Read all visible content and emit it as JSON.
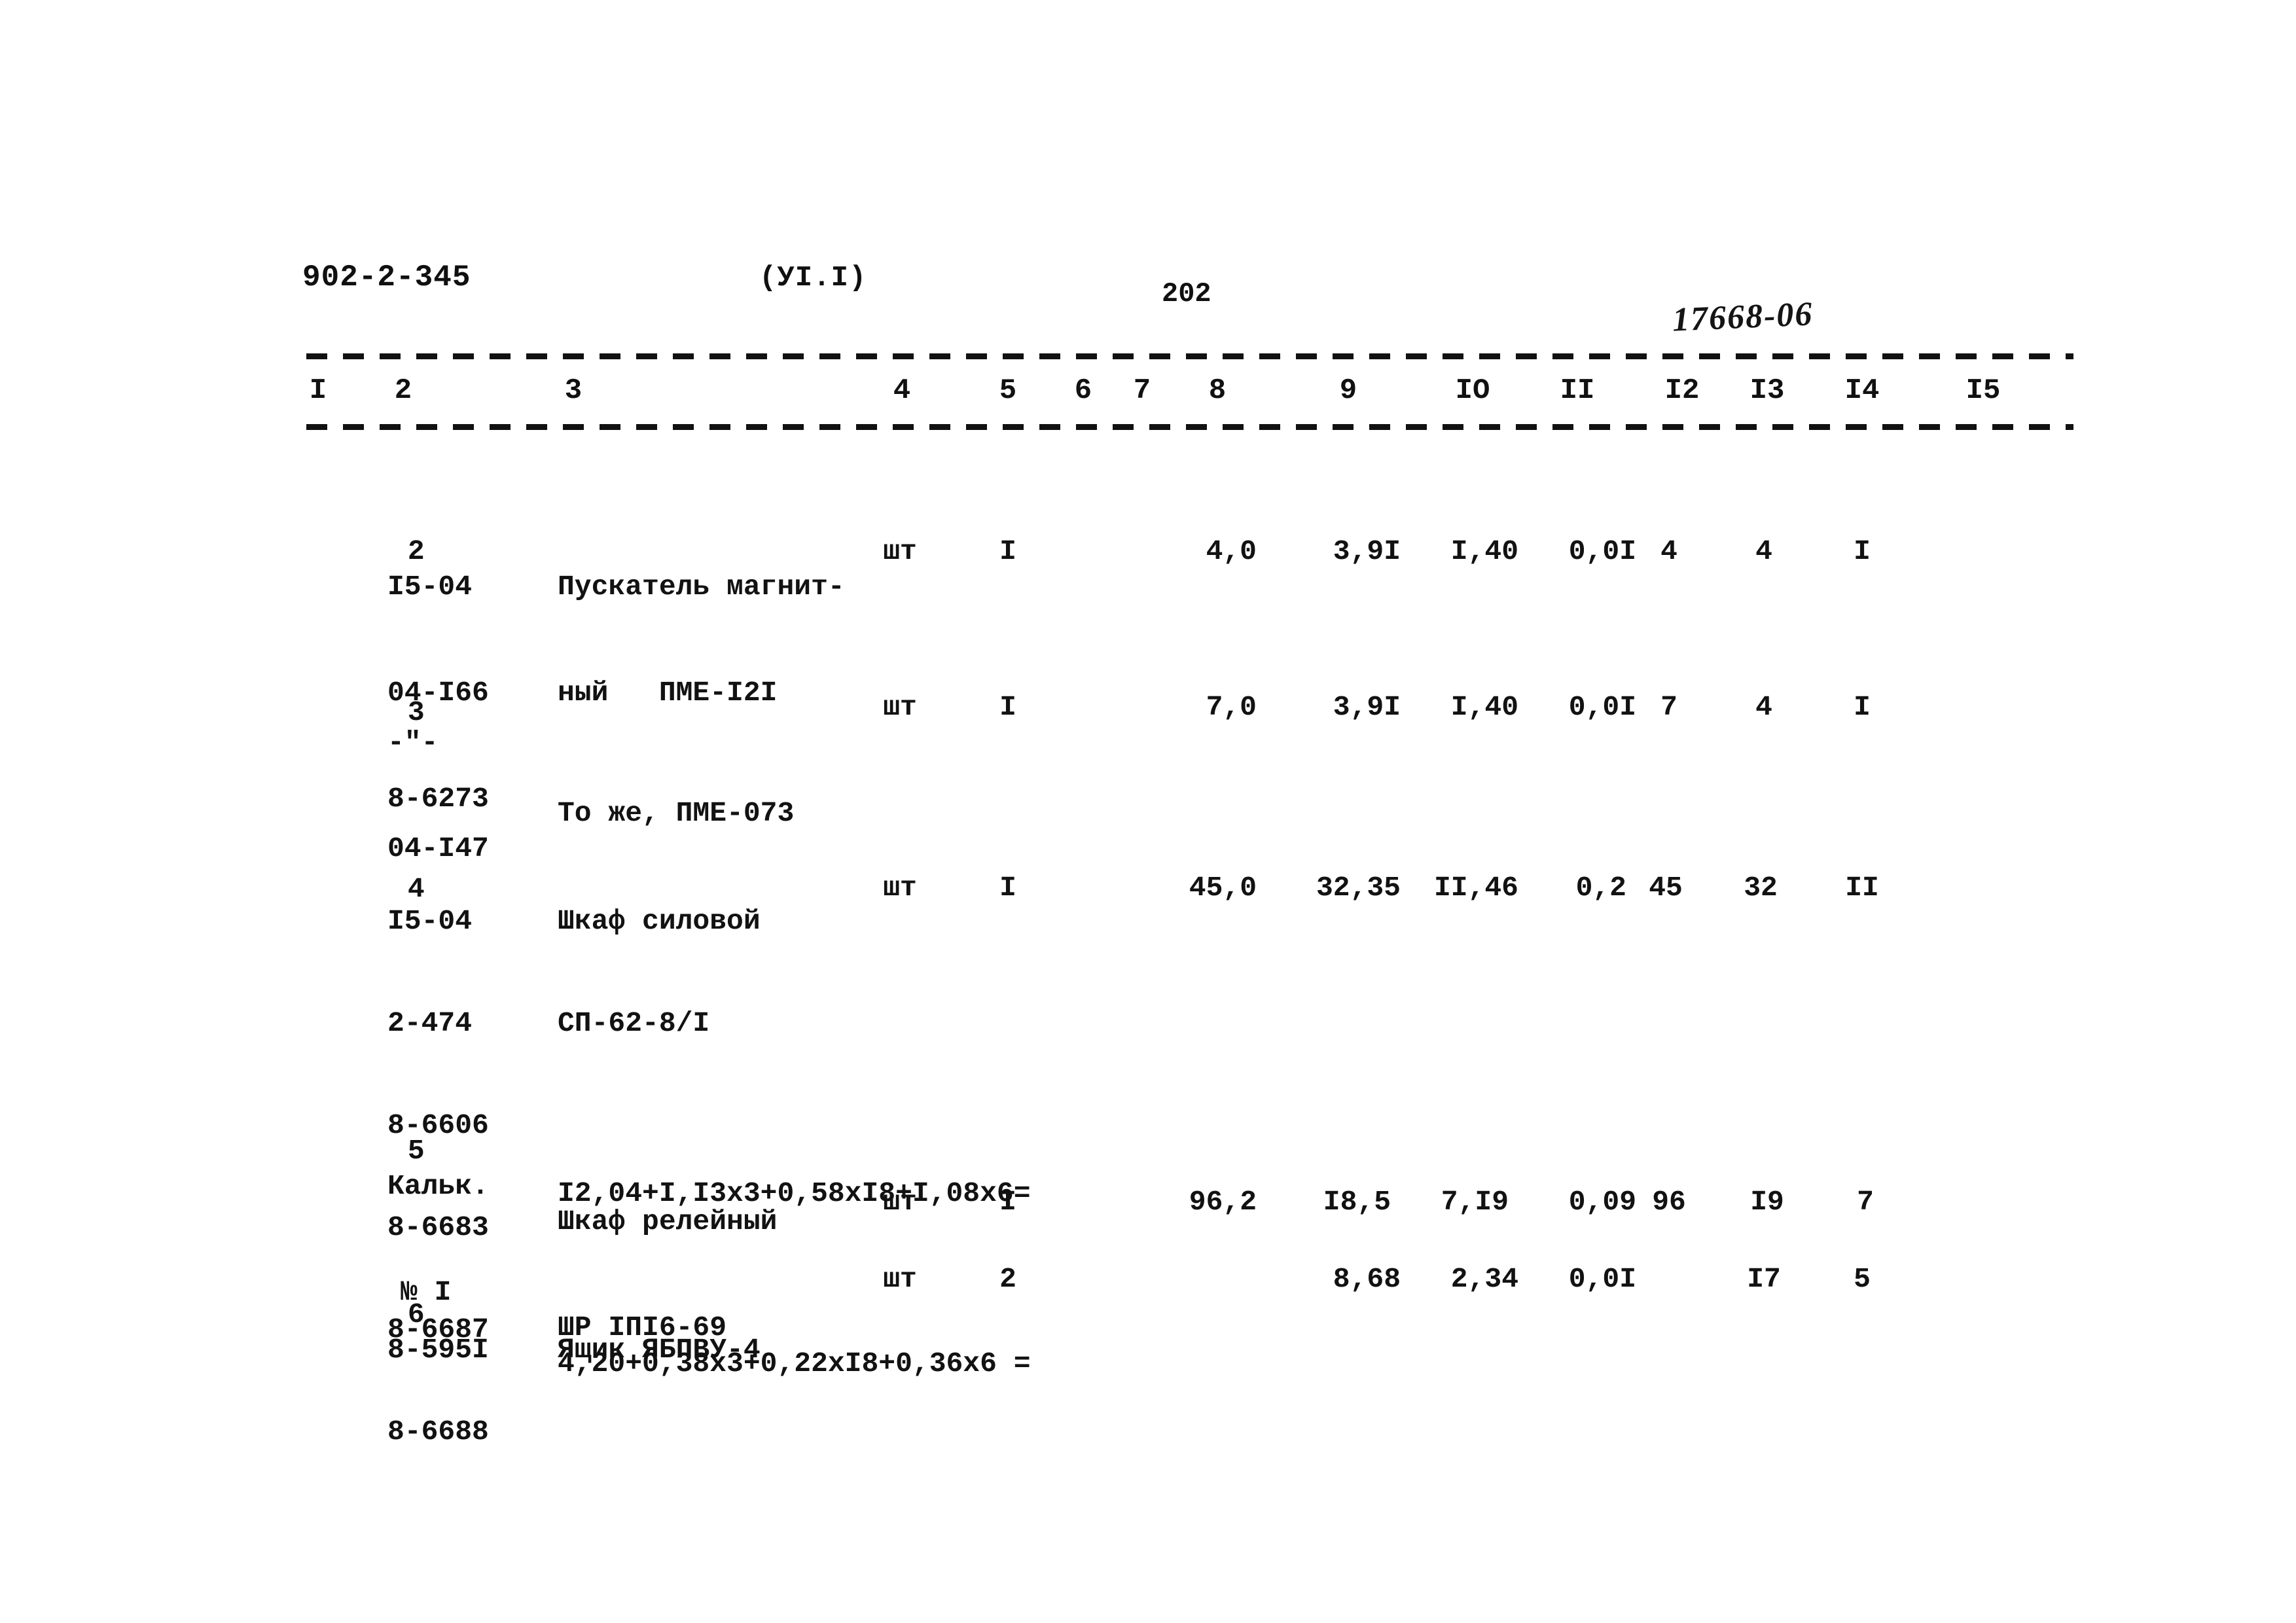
{
  "header": {
    "doc_code": "902-2-345",
    "section": "(УI.I)",
    "page_number": "202",
    "archive_stamp": "17668-06"
  },
  "table": {
    "column_headers": [
      "I",
      "2",
      "3",
      "4",
      "5",
      "6",
      "7",
      "8",
      "9",
      "IO",
      "II",
      "I2",
      "I3",
      "I4",
      "I5"
    ],
    "rows": [
      {
        "c1": "2",
        "c2_lines": [
          "I5-04",
          "04-I66",
          "8-6273"
        ],
        "c3_lines": [
          "Пускатель магнит-",
          "ный   ПМЕ-I2I"
        ],
        "c4": "шт",
        "c5": "I",
        "c6": "",
        "c7": "",
        "c8": "4,0",
        "c9": "3,9I",
        "c10": "I,40",
        "c11": "0,0I",
        "c12": "4",
        "c13": "4",
        "c14": "I",
        "c15": ""
      },
      {
        "c1": "3",
        "c2_lines": [
          "-\"-",
          "04-I47"
        ],
        "c3_lines": [
          "",
          "То же, ПМЕ-073"
        ],
        "c4": "шт",
        "c5": "I",
        "c6": "",
        "c7": "",
        "c8": "7,0",
        "c9": "3,9I",
        "c10": "I,40",
        "c11": "0,0I",
        "c12": "7",
        "c13": "4",
        "c14": "I",
        "c15": ""
      },
      {
        "c1": "4",
        "c2_lines": [
          "I5-04",
          "2-474",
          "8-6606",
          "8-6683",
          "8-6687",
          "8-6688"
        ],
        "c3_lines": [
          "Шкаф силовой",
          "СП-62-8/I",
          "",
          "I2,04+I,I3x3+0,58xI8+I,08x6=",
          "",
          "4,20+0,38x3+0,22xI8+0,36x6 ="
        ],
        "c4": "шт",
        "c5": "I",
        "c6": "",
        "c7": "",
        "c8": "45,0",
        "c9": "32,35",
        "c10": "II,46",
        "c11": "0,2",
        "c12": "45",
        "c13": "32",
        "c14": "II",
        "c15": ""
      },
      {
        "c1": "5",
        "c2_lines": [
          "Кальк.",
          "№ I"
        ],
        "c3_lines": [
          "Шкаф релейный",
          "ШР IПI6-69"
        ],
        "c4": "шт",
        "c5": "I",
        "c6": "",
        "c7": "",
        "c8": "96,2",
        "c9": "I8,5",
        "c10": "7,I9",
        "c11": "0,09",
        "c12": "96",
        "c13": "I9",
        "c14": "7",
        "c15": ""
      },
      {
        "c1": "6",
        "c2_lines": [
          "8-595I"
        ],
        "c3_lines": [
          "Ящик ЯБПВУ-4"
        ],
        "c4": "шт",
        "c5": "2",
        "c6": "",
        "c7": "",
        "c8": "",
        "c9": "8,68",
        "c10": "2,34",
        "c11": "0,0I",
        "c12": "",
        "c13": "I7",
        "c14": "5",
        "c15": ""
      }
    ]
  },
  "colors": {
    "ink": "#121212",
    "paper": "#ffffff"
  }
}
